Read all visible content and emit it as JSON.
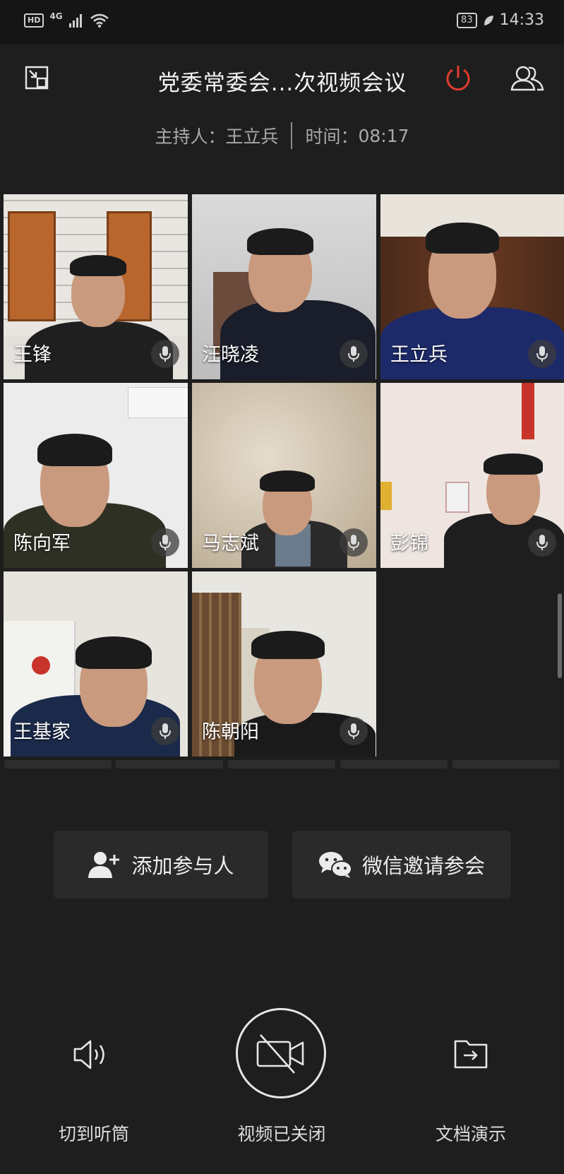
{
  "status": {
    "hd": "HD",
    "network": "4G",
    "battery": "83",
    "time": "14:33"
  },
  "header": {
    "title": "党委常委会...次视频会议",
    "host_label": "主持人：",
    "host_name": "王立兵",
    "time_label": "时间：",
    "elapsed": "08:17"
  },
  "participants": [
    {
      "name": "王锋"
    },
    {
      "name": "汪晓凌"
    },
    {
      "name": "王立兵"
    },
    {
      "name": "陈向军"
    },
    {
      "name": "马志斌"
    },
    {
      "name": "彭锦"
    },
    {
      "name": "王基家"
    },
    {
      "name": "陈朝阳"
    }
  ],
  "actions": {
    "add_participant": "添加参与人",
    "wechat_invite": "微信邀请参会"
  },
  "controls": {
    "speaker_label": "切到听筒",
    "video_label": "视频已关闭",
    "doc_label": "文档演示"
  },
  "colors": {
    "background": "#1e1e1e",
    "power_red": "#e03c2f",
    "button_bg": "#2a2a2a"
  }
}
